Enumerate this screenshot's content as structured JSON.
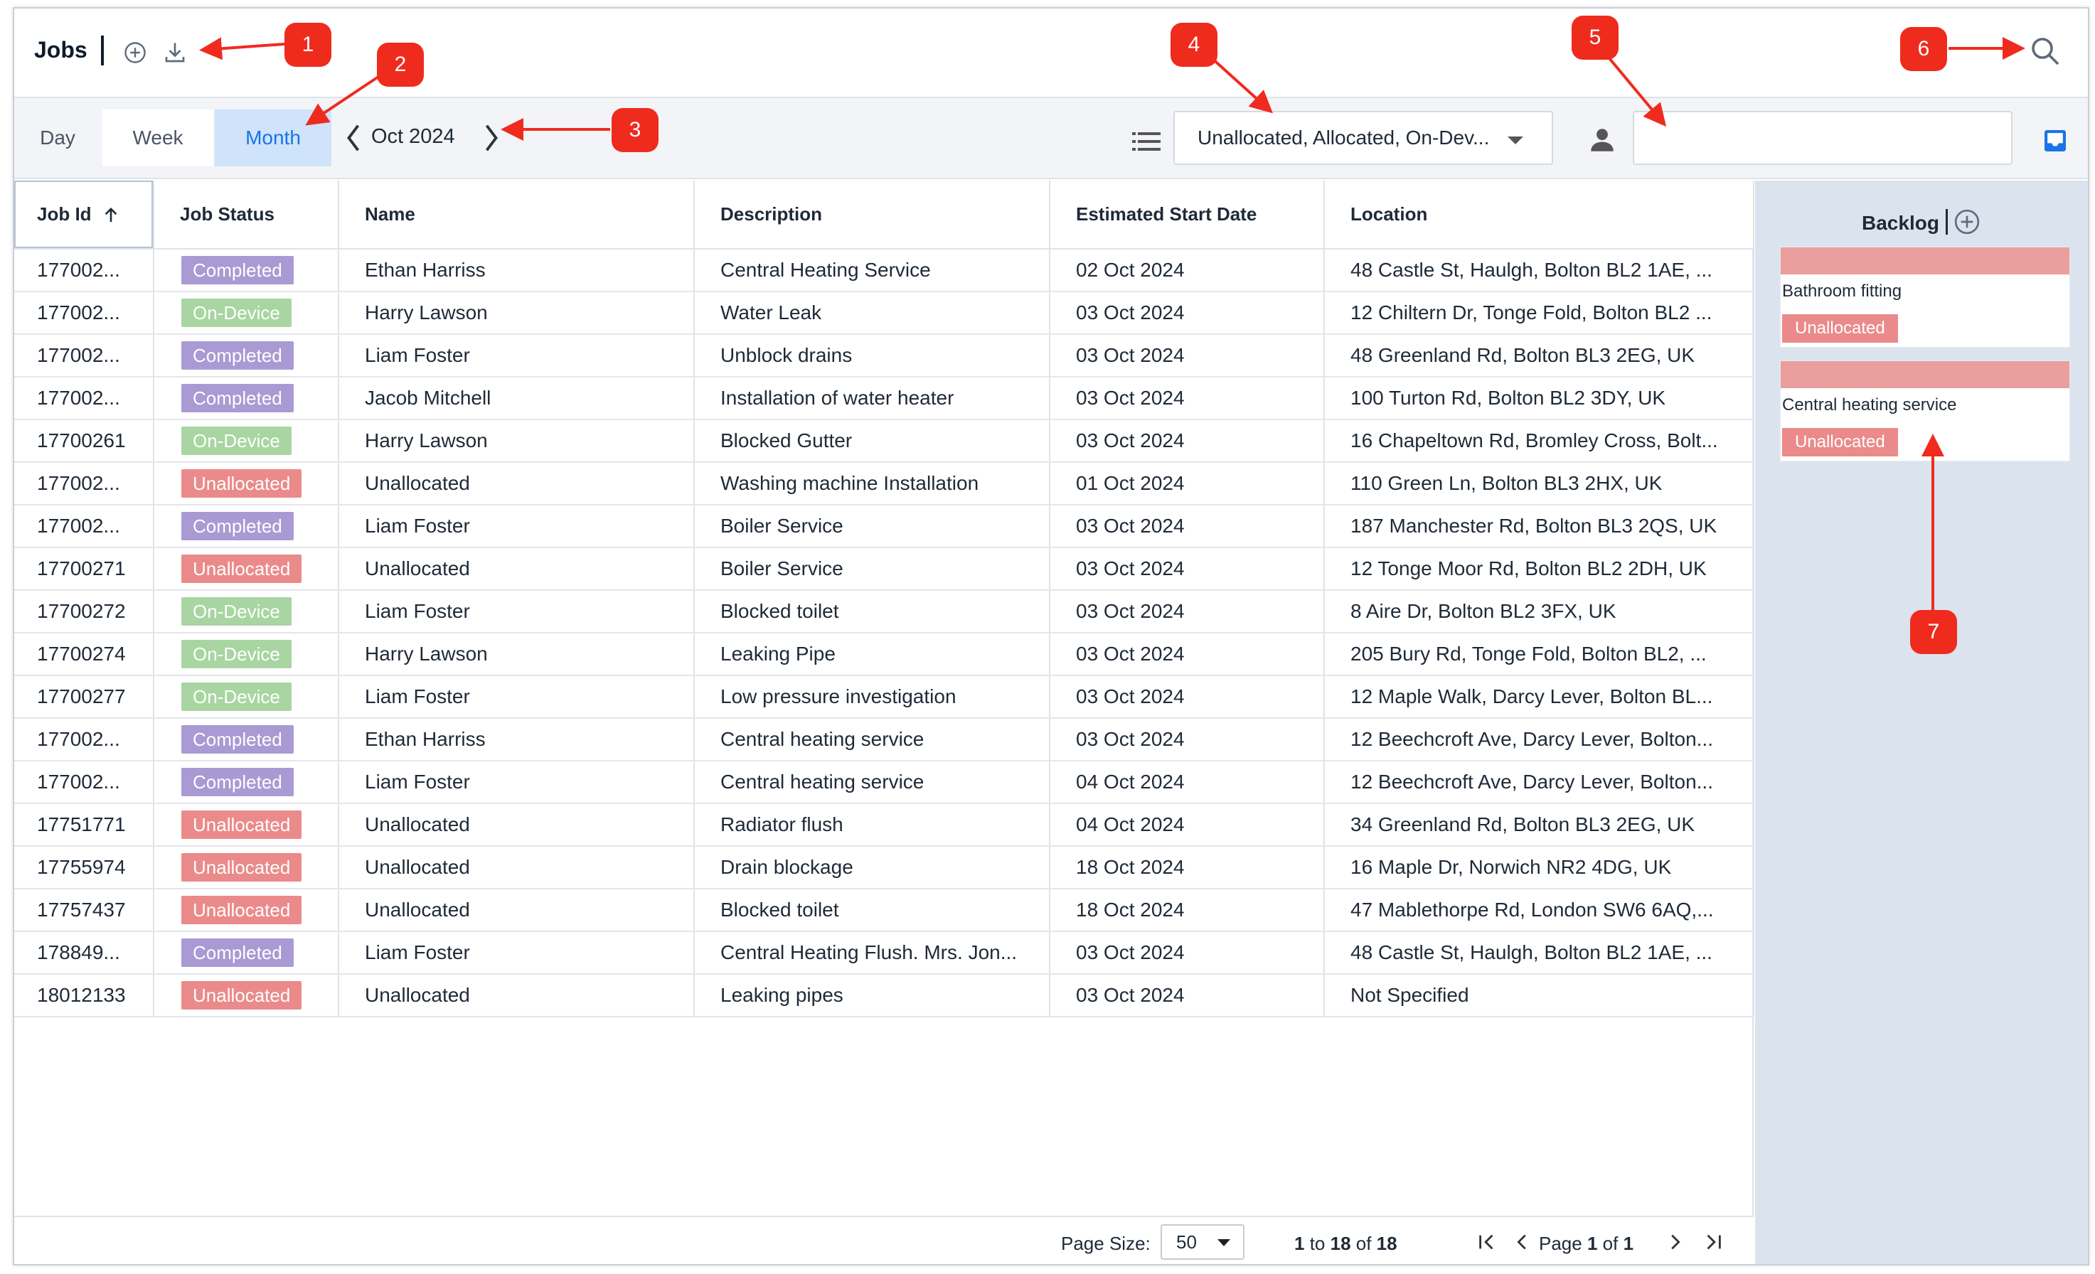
{
  "header": {
    "title": "Jobs"
  },
  "toolbar": {
    "views": [
      "Day",
      "Week",
      "Month"
    ],
    "active_view": "Month",
    "date_label": "Oct 2024",
    "status_filter": "Unallocated, Allocated, On-Dev...",
    "person_filter_value": ""
  },
  "table": {
    "columns": [
      "Job Id",
      "Job Status",
      "Name",
      "Description",
      "Estimated Start Date",
      "Location"
    ],
    "sorted_column": "Job Id",
    "rows": [
      {
        "id": "177002...",
        "status": "Completed",
        "name": "Ethan Harriss",
        "description": "Central Heating Service",
        "date": "02 Oct 2024",
        "location": "48 Castle St, Haulgh, Bolton BL2 1AE, ..."
      },
      {
        "id": "177002...",
        "status": "On-Device",
        "name": "Harry Lawson",
        "description": "Water Leak",
        "date": "03 Oct 2024",
        "location": "12 Chiltern Dr, Tonge Fold, Bolton BL2 ..."
      },
      {
        "id": "177002...",
        "status": "Completed",
        "name": "Liam Foster",
        "description": "Unblock drains",
        "date": "03 Oct 2024",
        "location": "48 Greenland Rd, Bolton BL3 2EG, UK"
      },
      {
        "id": "177002...",
        "status": "Completed",
        "name": "Jacob Mitchell",
        "description": "Installation of water heater",
        "date": "03 Oct 2024",
        "location": "100 Turton Rd, Bolton BL2 3DY, UK"
      },
      {
        "id": "17700261",
        "status": "On-Device",
        "name": "Harry Lawson",
        "description": "Blocked Gutter",
        "date": "03 Oct 2024",
        "location": "16 Chapeltown Rd, Bromley Cross, Bolt..."
      },
      {
        "id": "177002...",
        "status": "Unallocated",
        "name": "Unallocated",
        "description": "Washing machine Installation",
        "date": "01 Oct 2024",
        "location": "110 Green Ln, Bolton BL3 2HX, UK"
      },
      {
        "id": "177002...",
        "status": "Completed",
        "name": "Liam Foster",
        "description": "Boiler Service",
        "date": "03 Oct 2024",
        "location": "187 Manchester Rd, Bolton BL3 2QS, UK"
      },
      {
        "id": "17700271",
        "status": "Unallocated",
        "name": "Unallocated",
        "description": "Boiler Service",
        "date": "03 Oct 2024",
        "location": "12 Tonge Moor Rd, Bolton BL2 2DH, UK"
      },
      {
        "id": "17700272",
        "status": "On-Device",
        "name": "Liam Foster",
        "description": "Blocked toilet",
        "date": "03 Oct 2024",
        "location": "8 Aire Dr, Bolton BL2 3FX, UK"
      },
      {
        "id": "17700274",
        "status": "On-Device",
        "name": "Harry Lawson",
        "description": "Leaking Pipe",
        "date": "03 Oct 2024",
        "location": "205 Bury Rd, Tonge Fold, Bolton BL2, ..."
      },
      {
        "id": "17700277",
        "status": "On-Device",
        "name": "Liam Foster",
        "description": "Low pressure investigation",
        "date": "03 Oct 2024",
        "location": "12 Maple Walk, Darcy Lever, Bolton BL..."
      },
      {
        "id": "177002...",
        "status": "Completed",
        "name": "Ethan Harriss",
        "description": "Central heating service",
        "date": "03 Oct 2024",
        "location": "12 Beechcroft Ave, Darcy Lever, Bolton..."
      },
      {
        "id": "177002...",
        "status": "Completed",
        "name": "Liam Foster",
        "description": "Central heating service",
        "date": "04 Oct 2024",
        "location": "12 Beechcroft Ave, Darcy Lever, Bolton..."
      },
      {
        "id": "17751771",
        "status": "Unallocated",
        "name": "Unallocated",
        "description": "Radiator flush",
        "date": "04 Oct 2024",
        "location": "34 Greenland Rd, Bolton BL3 2EG, UK"
      },
      {
        "id": "17755974",
        "status": "Unallocated",
        "name": "Unallocated",
        "description": "Drain blockage",
        "date": "18 Oct 2024",
        "location": "16 Maple Dr, Norwich NR2 4DG, UK"
      },
      {
        "id": "17757437",
        "status": "Unallocated",
        "name": "Unallocated",
        "description": "Blocked toilet",
        "date": "18 Oct 2024",
        "location": "47 Mablethorpe Rd, London SW6 6AQ,..."
      },
      {
        "id": "178849...",
        "status": "Completed",
        "name": "Liam Foster",
        "description": "Central Heating Flush. Mrs. Jon...",
        "date": "03 Oct 2024",
        "location": "48 Castle St, Haulgh, Bolton BL2 1AE, ..."
      },
      {
        "id": "18012133",
        "status": "Unallocated",
        "name": "Unallocated",
        "description": "Leaking pipes",
        "date": "03 Oct 2024",
        "location": "Not Specified"
      }
    ]
  },
  "status_colors": {
    "Completed": "#a99ad3",
    "On-Device": "#a8d5a2",
    "Unallocated": "#eb8a8a"
  },
  "footer": {
    "page_size_label": "Page Size:",
    "page_size": "50",
    "range_from": "1",
    "range_to": "18",
    "range_total": "18",
    "page_current": "1",
    "page_total": "1"
  },
  "backlog": {
    "title": "Backlog",
    "cards": [
      {
        "title": "Bathroom fitting",
        "status": "Unallocated"
      },
      {
        "title": "Central heating service",
        "status": "Unallocated"
      }
    ]
  },
  "annotations": [
    "1",
    "2",
    "3",
    "4",
    "5",
    "6",
    "7"
  ],
  "icons": [
    "add-circle-icon",
    "download-icon",
    "search-icon",
    "chevron-left-icon",
    "chevron-right-icon",
    "list-icon",
    "person-icon",
    "inbox-icon",
    "sort-up-icon",
    "globe-icon",
    "first-page-icon",
    "prev-page-icon",
    "next-page-icon",
    "last-page-icon"
  ]
}
